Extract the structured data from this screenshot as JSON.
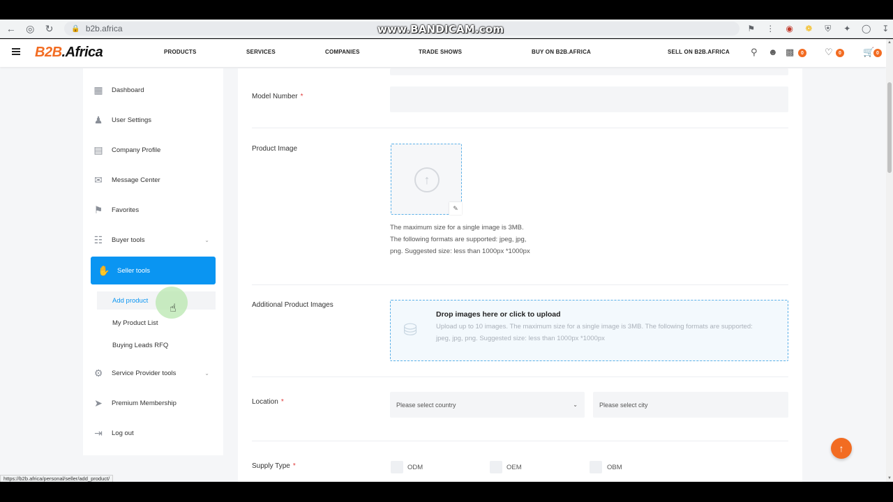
{
  "browser": {
    "url": "b2b.africa",
    "watermark": "www.BANDICAM.com",
    "status_url": "https://b2b.africa/personal/seller/add_product/"
  },
  "header": {
    "logo_main": "B2B",
    "logo_dot": ".Africa",
    "nav": [
      "PRODUCTS",
      "SERVICES",
      "COMPANIES",
      "TRADE SHOWS",
      "BUY ON B2B.AFRICA",
      "SELL ON B2B.AFRICA"
    ],
    "compare_count": "0",
    "favorites_count": "0",
    "cart_count": "0",
    "accent_color": "#f26c22"
  },
  "sidebar": {
    "items": [
      {
        "label": "Dashboard",
        "icon": "dashboard-icon"
      },
      {
        "label": "User Settings",
        "icon": "users-icon"
      },
      {
        "label": "Company Profile",
        "icon": "clipboard-icon"
      },
      {
        "label": "Message Center",
        "icon": "message-icon"
      },
      {
        "label": "Favorites",
        "icon": "bookmark-icon"
      },
      {
        "label": "Buyer tools",
        "icon": "basket-icon"
      },
      {
        "label": "Seller tools",
        "icon": "seller-icon"
      }
    ],
    "seller_sub": [
      "Add product",
      "My Product List",
      "Buying Leads RFQ"
    ],
    "after": [
      {
        "label": "Service Provider tools",
        "icon": "gear-user-icon"
      },
      {
        "label": "Premium Membership",
        "icon": "rocket-icon"
      },
      {
        "label": "Log out",
        "icon": "logout-icon"
      }
    ],
    "active_color": "#0a95f2"
  },
  "form": {
    "model_number_label": "Model Number",
    "product_image_label": "Product Image",
    "image_help": "The maximum size for a single image is 3MB. The following formats are supported: jpeg, jpg, png. Suggested size: less than 1000px *1000px",
    "additional_label": "Additional Product Images",
    "dropzone_title": "Drop images here or click to upload",
    "dropzone_text": "Upload up to 10 images. The maximum size for a single image is 3MB. The following formats are supported: jpeg, jpg, png. Suggested size: less than 1000px *1000px",
    "location_label": "Location",
    "country_placeholder": "Please select country",
    "city_placeholder": "Please select city",
    "supply_type_label": "Supply Type",
    "supply_options": [
      "ODM",
      "OEM",
      "OBM"
    ],
    "required_mark": "*"
  }
}
